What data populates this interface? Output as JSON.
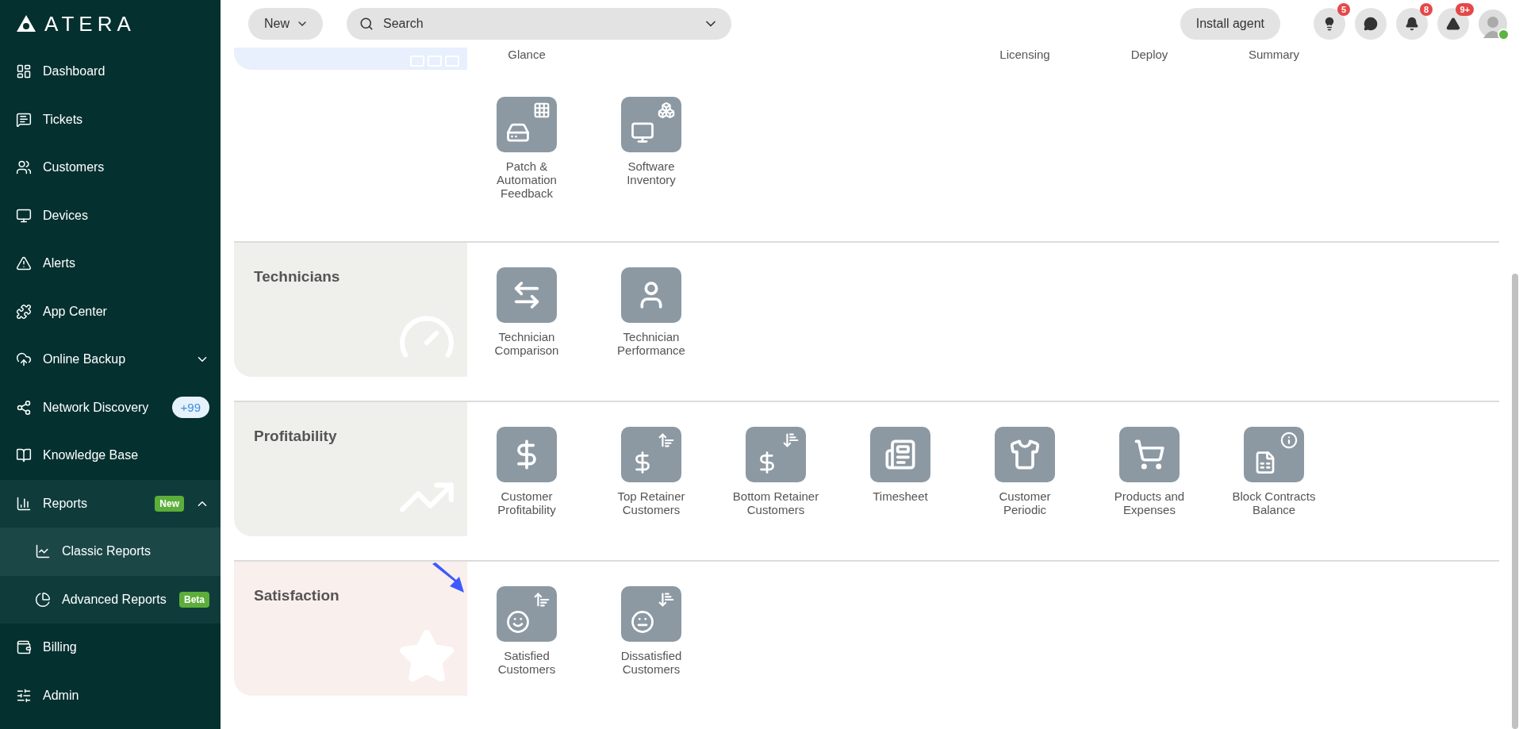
{
  "sidebar": {
    "logo": "ATERA",
    "items": [
      {
        "kind": "dashboard",
        "label": "Dashboard",
        "selected": false
      },
      {
        "kind": "tickets",
        "label": "Tickets",
        "selected": false
      },
      {
        "kind": "customers",
        "label": "Customers",
        "selected": false
      },
      {
        "kind": "devices",
        "label": "Devices",
        "selected": false
      },
      {
        "kind": "alerts",
        "label": "Alerts",
        "selected": false
      },
      {
        "kind": "apps",
        "label": "App Center",
        "selected": false
      },
      {
        "kind": "backup",
        "label": "Online Backup",
        "selected": false,
        "expanded": false
      },
      {
        "kind": "network",
        "label": "Network Discovery",
        "selected": false,
        "count": "+99"
      },
      {
        "kind": "knowledge",
        "label": "Knowledge Base",
        "selected": false
      },
      {
        "kind": "reports",
        "label": "Reports",
        "selected": false,
        "badge": "New",
        "expanded": true,
        "children": [
          {
            "kind": "classic",
            "label": "Classic Reports",
            "selected": true
          },
          {
            "kind": "advanced",
            "label": "Advanced Reports",
            "selected": false,
            "badge": "Beta"
          }
        ]
      },
      {
        "kind": "billing",
        "label": "Billing",
        "selected": false
      },
      {
        "kind": "admin",
        "label": "Admin",
        "selected": false
      }
    ]
  },
  "top_bar": {
    "new_button": "New",
    "search": {
      "placeholder": "Search"
    },
    "install_button": "Install agent",
    "icons": [
      {
        "kind": "tips",
        "badge": "5"
      },
      {
        "kind": "chat"
      },
      {
        "kind": "notifications",
        "badge": "8"
      },
      {
        "kind": "alerts",
        "badge": "9+"
      }
    ],
    "user": {
      "online": true
    }
  },
  "sections": [
    {
      "kind": "overview",
      "cut_labels_left": [
        "Glance"
      ],
      "cut_labels_right": [
        "Licensing",
        "Deploy",
        "Summary"
      ],
      "items": [
        {
          "kind": "patch",
          "label": "Patch & Automation Feedback"
        },
        {
          "kind": "software",
          "label": "Software Inventory"
        }
      ]
    },
    {
      "kind": "technicians",
      "title": "Technicians",
      "items": [
        {
          "kind": "compare",
          "label": "Technician Comparison"
        },
        {
          "kind": "person",
          "label": "Technician Performance"
        }
      ]
    },
    {
      "kind": "profitability",
      "title": "Profitability",
      "items": [
        {
          "kind": "dollar",
          "label": "Customer Profitability"
        },
        {
          "kind": "dollar-up",
          "label": "Top Retainer Customers"
        },
        {
          "kind": "dollar-down",
          "label": "Bottom Retainer Customers"
        },
        {
          "kind": "timesheet",
          "label": "Timesheet"
        },
        {
          "kind": "periodic",
          "label": "Customer Periodic"
        },
        {
          "kind": "cart",
          "label": "Products and Expenses"
        },
        {
          "kind": "contract",
          "label": "Block Contracts Balance"
        }
      ]
    },
    {
      "kind": "satisfaction",
      "title": "Satisfaction",
      "items": [
        {
          "kind": "smile-up",
          "label": "Satisfied Customers",
          "pointed": true
        },
        {
          "kind": "meh-down",
          "label": "Dissatisfied Customers"
        }
      ]
    }
  ]
}
